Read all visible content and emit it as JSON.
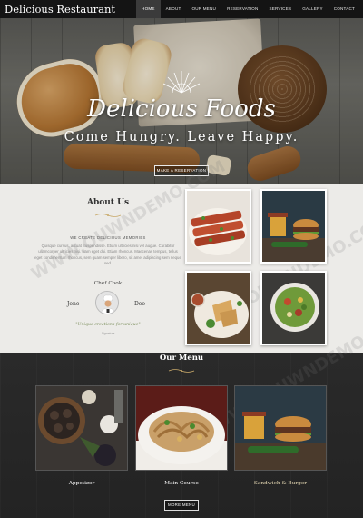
{
  "header": {
    "brand": "Delicious Restaurant",
    "nav": [
      {
        "label": "HOME",
        "active": true
      },
      {
        "label": "ABOUT",
        "active": false
      },
      {
        "label": "OUR MENU",
        "active": false
      },
      {
        "label": "RESERVATION",
        "active": false
      },
      {
        "label": "SERVICES",
        "active": false
      },
      {
        "label": "GALLERY",
        "active": false
      },
      {
        "label": "CONTACT",
        "active": false
      }
    ]
  },
  "hero": {
    "title": "Delicious Foods",
    "subtitle": "Come Hungry. Leave Happy.",
    "button_label": "MAKE A RESERVATION"
  },
  "about": {
    "title": "About Us",
    "tagline": "WE CREATE DELICIOUS MEMORIES",
    "body": "Quisque cursus, arcuat Suspendisse. Etiam ultricies nisi vel augue. Curabitur ullamcorper ultricies nisi. Nam eget dui. Etiam rhoncus. Maecenas tempus, tellus eget condimentum rhoncus, sem quam semper libero, sit amet adipiscing sem neque sed.",
    "chef_label": "Chef Cook",
    "chef_first": "Jone",
    "chef_last": "Deo",
    "quote": "\"Unique creations for unique\"",
    "signature": "Signature"
  },
  "menu": {
    "title": "Our Menu",
    "items": [
      {
        "caption": "Appetizer"
      },
      {
        "caption": "Main Course"
      },
      {
        "caption": "Sandwich & Burger"
      }
    ],
    "more_label": "MORE MENU"
  },
  "watermark": "WWW.OUWNDEMO.COM",
  "colors": {
    "nav_bg": "#141414",
    "about_bg": "#ecebe8",
    "menu_bg": "#262626",
    "accent_gold": "#c8a96a",
    "quote_green": "#7c8f5d"
  }
}
